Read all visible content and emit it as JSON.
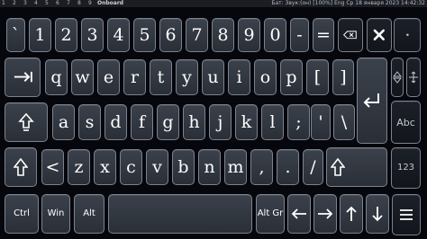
{
  "topbar": {
    "workspaces": [
      "1",
      "2",
      "3",
      "4",
      "5",
      "6",
      "7",
      "8",
      "9"
    ],
    "app_name": "Onboard",
    "status": "Бат: Звук:(он) [100%] Eng Ср 18 января 2023 14:42:32"
  },
  "keyboard": {
    "row1": [
      "`",
      "1",
      "2",
      "3",
      "4",
      "5",
      "6",
      "7",
      "8",
      "9",
      "0",
      "-",
      "="
    ],
    "row2": [
      "q",
      "w",
      "e",
      "r",
      "t",
      "y",
      "u",
      "i",
      "o",
      "p",
      "[",
      "]"
    ],
    "row3": [
      "a",
      "s",
      "d",
      "f",
      "g",
      "h",
      "j",
      "k",
      "l",
      ";",
      "'",
      "\\"
    ],
    "row4": [
      "<",
      "z",
      "x",
      "c",
      "v",
      "b",
      "n",
      "m",
      ",",
      ".",
      "/"
    ],
    "abc_label": "Abc",
    "num_label": "123",
    "ctrl_label": "Ctrl",
    "win_label": "Win",
    "alt_label": "Alt",
    "altgr_label": "Alt Gr"
  },
  "icons": {
    "backspace": "backspace-icon",
    "close": "close-icon",
    "tab": "tab-icon",
    "enter": "enter-icon",
    "caps": "caps-lock-icon",
    "shift": "shift-icon",
    "arrows": "arrow-icons",
    "move": "move-icon",
    "resize": "resize-icon",
    "menu": "menu-icon"
  }
}
